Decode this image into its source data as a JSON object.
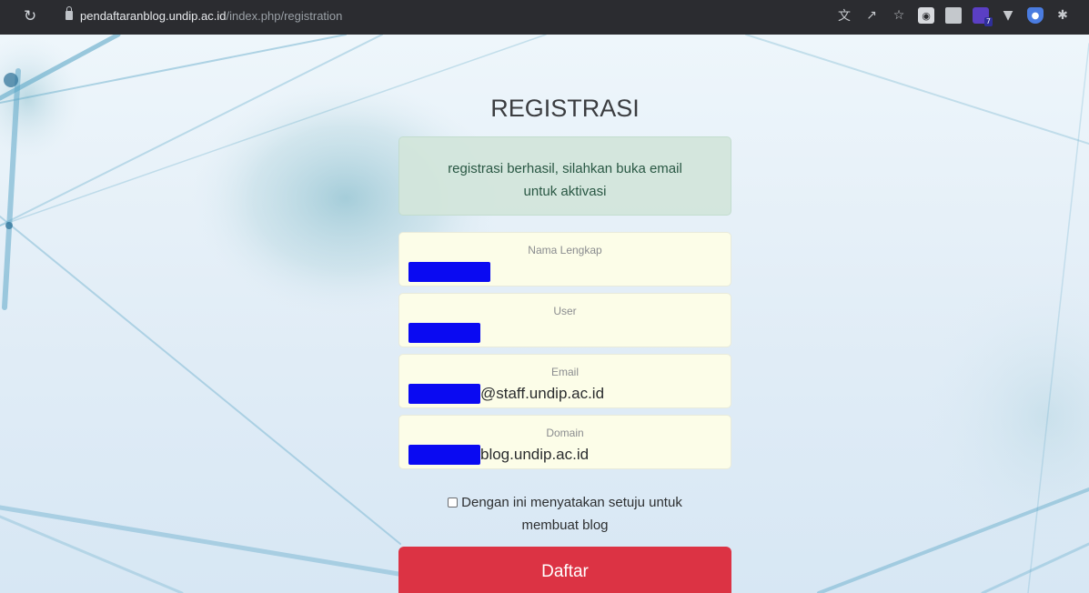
{
  "browser": {
    "url_host": "pendaftaranblog.undip.ac.id",
    "url_path": "/index.php/registration",
    "extension_badge": "7"
  },
  "page": {
    "title": "REGISTRASI",
    "alert": "registrasi berhasil, silahkan buka email untuk aktivasi"
  },
  "form": {
    "nama_lengkap_label": "Nama Lengkap",
    "user_label": "User",
    "email_label": "Email",
    "email_suffix": "@staff.undip.ac.id",
    "domain_label": "Domain",
    "domain_suffix": "blog.undip.ac.id",
    "agree_text": "Dengan ini menyatakan setuju untuk membuat blog",
    "submit_label": "Daftar"
  },
  "colors": {
    "submit": "#dc3344",
    "alert_bg": "#d3e6dc",
    "field_bg": "#fcfde8",
    "redaction": "#0a0af2"
  }
}
